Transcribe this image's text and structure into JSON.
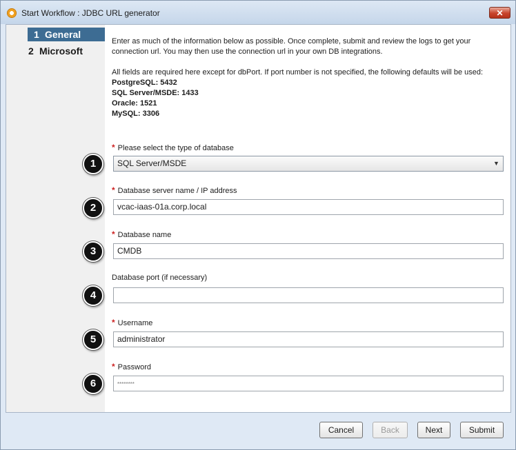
{
  "window": {
    "title": "Start Workflow : JDBC URL generator",
    "close_glyph": "✕"
  },
  "sidebar": {
    "steps": [
      {
        "num": "1",
        "label": "General",
        "active": true
      },
      {
        "num": "2",
        "label": "Microsoft",
        "active": false
      }
    ]
  },
  "intro": {
    "line1": "Enter as much of the information below as possible. Once complete, submit and review the logs to get your",
    "line2": "connection url. You may then use the connection url in your own DB integrations.",
    "line3": "All fields are required here except for dbPort. If port number is not specified, the following defaults will be used:",
    "defaults": [
      "PostgreSQL: 5432",
      "SQL Server/MSDE: 1433",
      "Oracle: 1521",
      "MySQL: 3306"
    ]
  },
  "fields": {
    "db_type": {
      "label": "Please select the type of database",
      "value": "SQL Server/MSDE",
      "required": true,
      "badge": "1"
    },
    "server": {
      "label": "Database server name / IP address",
      "value": "vcac-iaas-01a.corp.local",
      "required": true,
      "badge": "2"
    },
    "db_name": {
      "label": "Database name",
      "value": "CMDB",
      "required": true,
      "badge": "3"
    },
    "port": {
      "label": "Database port (if necessary)",
      "value": "",
      "required": false,
      "badge": "4"
    },
    "username": {
      "label": "Username",
      "value": "administrator",
      "required": true,
      "badge": "5"
    },
    "password": {
      "label": "Password",
      "value": "********",
      "required": true,
      "badge": "6"
    }
  },
  "required_marker": "*",
  "buttons": {
    "cancel": "Cancel",
    "back": "Back",
    "next": "Next",
    "submit": "Submit"
  },
  "icons": {
    "window": "workflow-icon",
    "dropdown": "chevron-down-icon"
  },
  "colors": {
    "active_step": "#3d6c93",
    "required": "#cc2222",
    "titlebar": "#c5d6ea"
  }
}
